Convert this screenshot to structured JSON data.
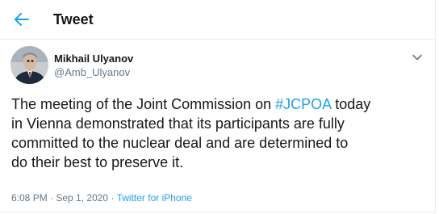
{
  "header": {
    "back_icon": "arrow-left-icon",
    "title": "Tweet"
  },
  "author": {
    "name": "Mikhail Ulyanov",
    "handle": "@Amb_Ulyanov",
    "avatar": "profile-photo",
    "more_icon": "chevron-down-icon"
  },
  "tweet": {
    "line1_before": "The meeting of the Joint Commission on ",
    "hashtag": "#JCPOA",
    "line1_after": " today",
    "line2": "in Vienna demonstrated that its participants are fully",
    "line3": "committed to the nuclear deal and are determined to",
    "line4": "do their best to preserve it."
  },
  "meta": {
    "time": "6:08 PM",
    "separator1": " · ",
    "date": "Sep 1, 2020",
    "separator2": " · ",
    "source": "Twitter for iPhone"
  },
  "colors": {
    "accent": "#1da1f2",
    "text": "#14171a",
    "muted": "#657786",
    "border": "#e6ecf0"
  }
}
